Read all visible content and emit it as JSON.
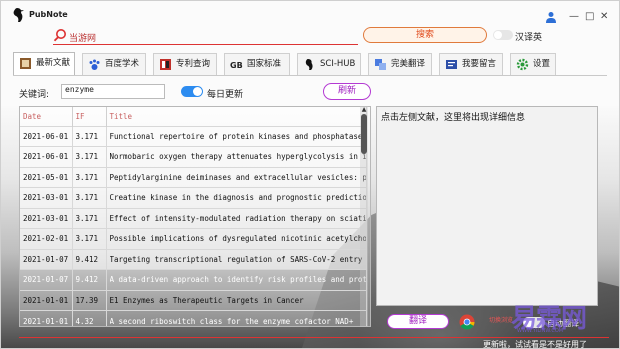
{
  "app": {
    "title": "PubNote"
  },
  "window_controls": {
    "user": "user-icon",
    "minimize": "—",
    "maximize": "□",
    "close": "✕"
  },
  "search": {
    "engine_label": "当游网",
    "button": "搜索",
    "toggle_label": "汉译英"
  },
  "tabs": [
    {
      "label": "最新文献",
      "icon": "book-icon",
      "active": true
    },
    {
      "label": "百度学术",
      "icon": "paw-icon"
    },
    {
      "label": "专利查询",
      "icon": "patent-icon"
    },
    {
      "label": "国家标准",
      "icon": "gb-icon"
    },
    {
      "label": "SCI-HUB",
      "icon": "raven-icon"
    },
    {
      "label": "完美翻译",
      "icon": "translate-icon"
    },
    {
      "label": "我要留言",
      "icon": "message-icon"
    },
    {
      "label": "设置",
      "icon": "gear-icon"
    }
  ],
  "controls": {
    "keyword_label": "关键词:",
    "keyword_value": "enzyme",
    "daily_update_label": "每日更新",
    "daily_update_on": true,
    "refresh_button": "刷新"
  },
  "table": {
    "headers": [
      "Date",
      "IF",
      "Title"
    ],
    "rows": [
      {
        "date": "2021-06-01",
        "if": "3.171",
        "title": "Functional repertoire of protein kinases and phosphatases in"
      },
      {
        "date": "2021-06-01",
        "if": "3.171",
        "title": "Normobaric oxygen therapy attenuates hyperglycolysis in ische"
      },
      {
        "date": "2021-05-01",
        "if": "3.171",
        "title": "Peptidylarginine deiminases and extracellular vesicles: prosp"
      },
      {
        "date": "2021-03-01",
        "if": "3.171",
        "title": "Creatine kinase in the diagnosis and prognostic prediction of"
      },
      {
        "date": "2021-03-01",
        "if": "3.171",
        "title": "Effect of intensity-modulated radiation therapy on sciatic ne"
      },
      {
        "date": "2021-02-01",
        "if": "3.171",
        "title": "Possible implications of dysregulated nicotinic acetylcholine"
      },
      {
        "date": "2021-01-07",
        "if": "9.412",
        "title": "Targeting transcriptional regulation of SARS-CoV-2 entry fact"
      },
      {
        "date": "2021-01-07",
        "if": "9.412",
        "title": "A data-driven approach to identify risk profiles and protecti"
      },
      {
        "date": "2021-01-01",
        "if": "17.39",
        "title": "E1 Enzymes as Therapeutic Targets in Cancer"
      },
      {
        "date": "2021-01-01",
        "if": "4.32",
        "title": "A second riboswitch class for the enzyme cofactor NAD+"
      }
    ]
  },
  "detail": {
    "placeholder": "点击左侧文献，这里将出现详细信息"
  },
  "bottom": {
    "translate_button": "翻译",
    "browser_icon": "chrome-icon",
    "mini_text": "切换浏览",
    "toggle_label": "自动翻译",
    "status": "更新啦，试试看是不是好用了"
  },
  "watermark": {
    "text": "易霖网",
    "sub": "WWW.YILINW.COM"
  }
}
